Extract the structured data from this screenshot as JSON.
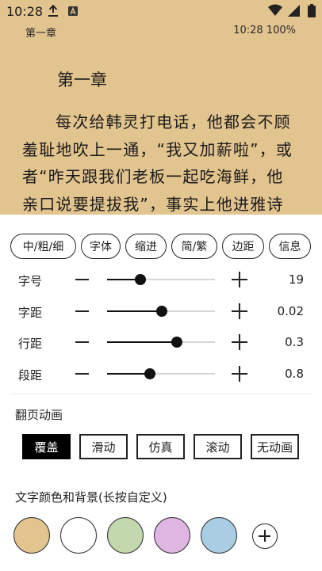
{
  "status_bar": {
    "time": "10:28",
    "icons": [
      "download-icon",
      "a-notification-icon",
      "wifi-icon",
      "cellular-icon",
      "battery-icon"
    ]
  },
  "reader": {
    "chapter_header": "第一章",
    "time_battery": "10:28 100%",
    "chapter_title": "第一章",
    "body_lines": [
      "每次给韩灵打电话，他都会不顾",
      "羞耻地吹上一通，“我又加薪啦”，或",
      "者“昨天跟我们老板一起吃海鲜，他",
      "亲口说要提拔我”，事实上他进雅诗"
    ],
    "background_color": "#e2c48f"
  },
  "panel": {
    "chips": [
      "中/粗/细",
      "字体",
      "缩进",
      "简/繁",
      "边距",
      "信息"
    ],
    "sliders": [
      {
        "label": "字号",
        "value": "19",
        "fraction": 0.31
      },
      {
        "label": "字距",
        "value": "0.02",
        "fraction": 0.51
      },
      {
        "label": "行距",
        "value": "0.3",
        "fraction": 0.65
      },
      {
        "label": "段距",
        "value": "0.8",
        "fraction": 0.4
      }
    ],
    "page_anim_title": "翻页动画",
    "page_anims": [
      "覆盖",
      "滑动",
      "仿真",
      "滚动",
      "无动画"
    ],
    "selected_anim": "覆盖",
    "color_title": "文字颜色和背景(长按自定义)",
    "swatches": [
      "#e2c48f",
      "#ffffff",
      "#c3d9ad",
      "#dfb6e2",
      "#a9cde2"
    ]
  }
}
